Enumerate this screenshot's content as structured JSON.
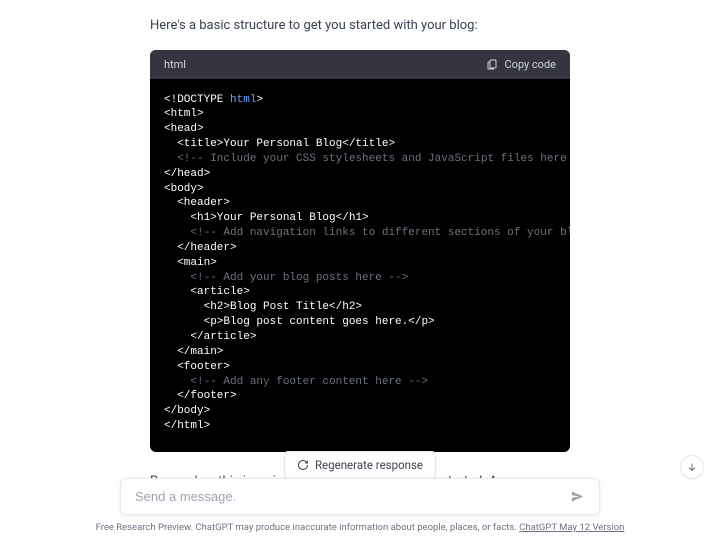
{
  "intro": "Here's a basic structure to get you started with your blog:",
  "code": {
    "language": "html",
    "copy_label": "Copy code",
    "lines": [
      {
        "indent": 0,
        "segments": [
          {
            "t": "<!DOCTYPE ",
            "c": "kw"
          },
          {
            "t": "html",
            "c": "hl"
          },
          {
            "t": ">",
            "c": "kw"
          }
        ]
      },
      {
        "indent": 0,
        "segments": [
          {
            "t": "<html>",
            "c": "kw"
          }
        ]
      },
      {
        "indent": 0,
        "segments": [
          {
            "t": "<head>",
            "c": "kw"
          }
        ]
      },
      {
        "indent": 1,
        "segments": [
          {
            "t": "<title>Your Personal Blog</title>",
            "c": "kw"
          }
        ]
      },
      {
        "indent": 1,
        "segments": [
          {
            "t": "<!-- Include your CSS stylesheets and JavaScript files here -->",
            "c": "cmt"
          }
        ]
      },
      {
        "indent": 0,
        "segments": [
          {
            "t": "</head>",
            "c": "kw"
          }
        ]
      },
      {
        "indent": 0,
        "segments": [
          {
            "t": "<body>",
            "c": "kw"
          }
        ]
      },
      {
        "indent": 1,
        "segments": [
          {
            "t": "<header>",
            "c": "kw"
          }
        ]
      },
      {
        "indent": 2,
        "segments": [
          {
            "t": "<h1>Your Personal Blog</h1>",
            "c": "kw"
          }
        ]
      },
      {
        "indent": 2,
        "segments": [
          {
            "t": "<!-- Add navigation links to different sections of your blog -->",
            "c": "cmt"
          }
        ]
      },
      {
        "indent": 1,
        "segments": [
          {
            "t": "</header>",
            "c": "kw"
          }
        ]
      },
      {
        "indent": 0,
        "segments": [
          {
            "t": "",
            "c": "kw"
          }
        ]
      },
      {
        "indent": 1,
        "segments": [
          {
            "t": "<main>",
            "c": "kw"
          }
        ]
      },
      {
        "indent": 2,
        "segments": [
          {
            "t": "<!-- Add your blog posts here -->",
            "c": "cmt"
          }
        ]
      },
      {
        "indent": 2,
        "segments": [
          {
            "t": "<article>",
            "c": "kw"
          }
        ]
      },
      {
        "indent": 3,
        "segments": [
          {
            "t": "<h2>Blog Post Title</h2>",
            "c": "kw"
          }
        ]
      },
      {
        "indent": 3,
        "segments": [
          {
            "t": "<p>Blog post content goes here.</p>",
            "c": "kw"
          }
        ]
      },
      {
        "indent": 2,
        "segments": [
          {
            "t": "</article>",
            "c": "kw"
          }
        ]
      },
      {
        "indent": 1,
        "segments": [
          {
            "t": "</main>",
            "c": "kw"
          }
        ]
      },
      {
        "indent": 0,
        "segments": [
          {
            "t": "",
            "c": "kw"
          }
        ]
      },
      {
        "indent": 1,
        "segments": [
          {
            "t": "<footer>",
            "c": "kw"
          }
        ]
      },
      {
        "indent": 2,
        "segments": [
          {
            "t": "<!-- Add any footer content here -->",
            "c": "cmt"
          }
        ]
      },
      {
        "indent": 1,
        "segments": [
          {
            "t": "</footer>",
            "c": "kw"
          }
        ]
      },
      {
        "indent": 0,
        "segments": [
          {
            "t": "</body>",
            "c": "kw"
          }
        ]
      },
      {
        "indent": 0,
        "segments": [
          {
            "t": "</html>",
            "c": "kw"
          }
        ]
      }
    ]
  },
  "outro": "Remember, this is a simplified structure to get you started. As you develop your blog",
  "regenerate_label": "Regenerate response",
  "input_placeholder": "Send a message.",
  "footer": {
    "text": "Free Research Preview. ChatGPT may produce inaccurate information about people, places, or facts. ",
    "link": "ChatGPT May 12 Version"
  }
}
